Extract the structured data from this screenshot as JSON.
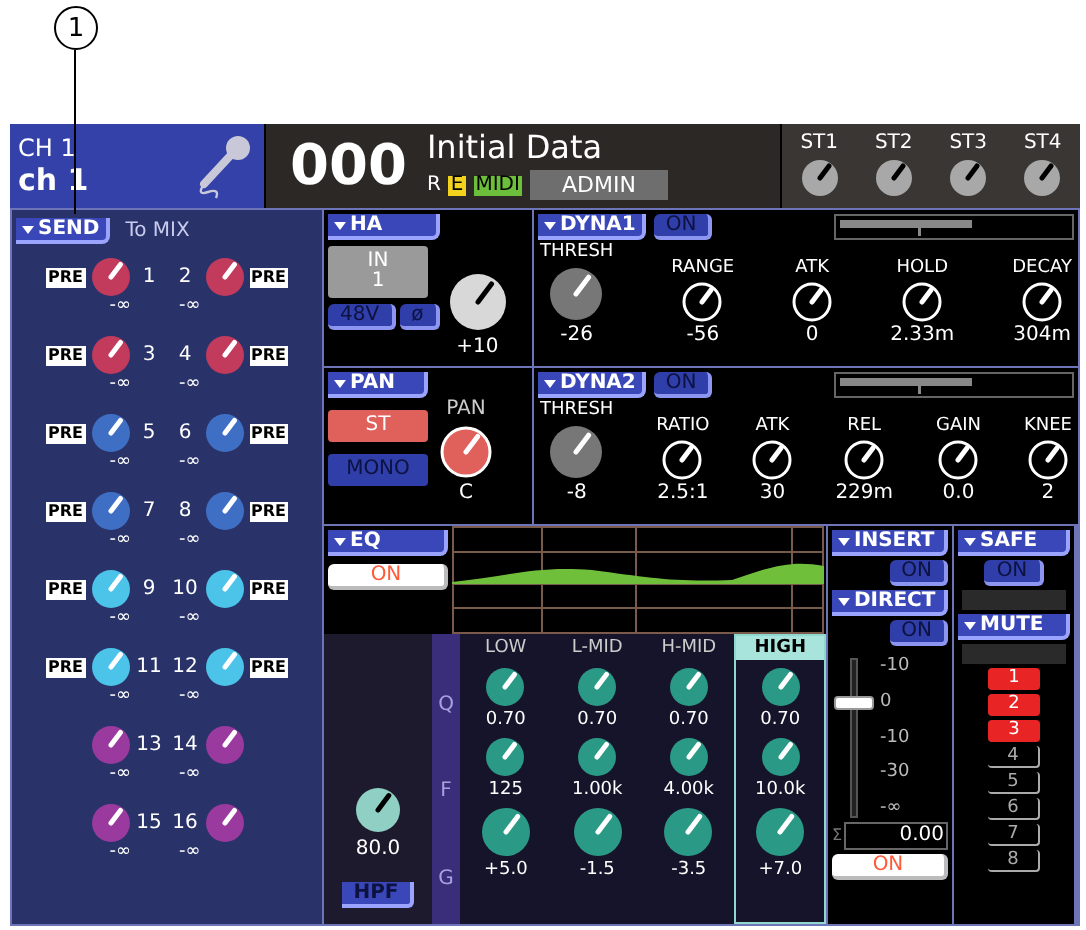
{
  "callout": "1",
  "header": {
    "channel_id": "CH 1",
    "channel_name": "ch 1",
    "scene_number": "000",
    "scene_title": "Initial Data",
    "indicators": [
      {
        "label": "R",
        "kind": "plain"
      },
      {
        "label": "E",
        "kind": "yellow"
      },
      {
        "label": "MIDI",
        "kind": "green"
      }
    ],
    "user": "ADMIN",
    "st_knobs": [
      {
        "label": "ST1"
      },
      {
        "label": "ST2"
      },
      {
        "label": "ST3"
      },
      {
        "label": "ST4"
      }
    ]
  },
  "send": {
    "button": "SEND",
    "title": "To MIX",
    "sends": [
      {
        "number": "1",
        "value": "-∞",
        "tag": "PRE",
        "color": "#c23a5c"
      },
      {
        "number": "2",
        "value": "-∞",
        "tag": "PRE",
        "color": "#c23a5c"
      },
      {
        "number": "3",
        "value": "-∞",
        "tag": "PRE",
        "color": "#c23a5c"
      },
      {
        "number": "4",
        "value": "-∞",
        "tag": "PRE",
        "color": "#c23a5c"
      },
      {
        "number": "5",
        "value": "-∞",
        "tag": "PRE",
        "color": "#3f6fc4"
      },
      {
        "number": "6",
        "value": "-∞",
        "tag": "PRE",
        "color": "#3f6fc4"
      },
      {
        "number": "7",
        "value": "-∞",
        "tag": "PRE",
        "color": "#3f6fc4"
      },
      {
        "number": "8",
        "value": "-∞",
        "tag": "PRE",
        "color": "#3f6fc4"
      },
      {
        "number": "9",
        "value": "-∞",
        "tag": "PRE",
        "color": "#4cc3e8"
      },
      {
        "number": "10",
        "value": "-∞",
        "tag": "PRE",
        "color": "#4cc3e8"
      },
      {
        "number": "11",
        "value": "-∞",
        "tag": "PRE",
        "color": "#4cc3e8"
      },
      {
        "number": "12",
        "value": "-∞",
        "tag": "PRE",
        "color": "#4cc3e8"
      },
      {
        "number": "13",
        "value": "-∞",
        "color": "#9a3a9e"
      },
      {
        "number": "14",
        "value": "-∞",
        "color": "#9a3a9e"
      },
      {
        "number": "15",
        "value": "-∞",
        "color": "#9a3a9e"
      },
      {
        "number": "16",
        "value": "-∞",
        "color": "#9a3a9e"
      }
    ]
  },
  "ha": {
    "button": "HA",
    "input": [
      "IN",
      "1"
    ],
    "phantom": "48V",
    "phase": "ø",
    "value": "+10"
  },
  "pan": {
    "button": "PAN",
    "st": "ST",
    "st_on": true,
    "mono": "MONO",
    "mono_on": false,
    "label": "PAN",
    "value": "C"
  },
  "dyna1": {
    "button": "DYNA1",
    "on": "ON",
    "params": [
      {
        "label": "THRESH",
        "value": "-26"
      },
      {
        "label": "RANGE",
        "value": "-56"
      },
      {
        "label": "ATK",
        "value": "0"
      },
      {
        "label": "HOLD",
        "value": "2.33m"
      },
      {
        "label": "DECAY",
        "value": "304m"
      }
    ]
  },
  "dyna2": {
    "button": "DYNA2",
    "on": "ON",
    "params": [
      {
        "label": "THRESH",
        "value": "-8"
      },
      {
        "label": "RATIO",
        "value": "2.5:1"
      },
      {
        "label": "ATK",
        "value": "30"
      },
      {
        "label": "REL",
        "value": "229m"
      },
      {
        "label": "GAIN",
        "value": "0.0"
      },
      {
        "label": "KNEE",
        "value": "2"
      }
    ]
  },
  "eq": {
    "button": "EQ",
    "on": "ON",
    "hpf_value": "80.0",
    "hpf": "HPF",
    "row_labels": [
      "Q",
      "F",
      "G"
    ],
    "bands": [
      {
        "name": "LOW",
        "selected": false,
        "values": [
          "0.70",
          "125",
          "+5.0"
        ]
      },
      {
        "name": "L-MID",
        "selected": false,
        "values": [
          "0.70",
          "1.00k",
          "-1.5"
        ]
      },
      {
        "name": "H-MID",
        "selected": false,
        "values": [
          "0.70",
          "4.00k",
          "-3.5"
        ]
      },
      {
        "name": "HIGH",
        "selected": true,
        "values": [
          "0.70",
          "10.0k",
          "+7.0"
        ]
      }
    ]
  },
  "insert": {
    "button": "INSERT",
    "on": "ON"
  },
  "direct": {
    "button": "DIRECT",
    "on": "ON"
  },
  "fader": {
    "scale": [
      "-10",
      "0",
      "-10",
      "-30",
      "-∞"
    ],
    "level": 0.75,
    "sum": "Σ",
    "value": "0.00",
    "on": "ON"
  },
  "safe": {
    "button": "SAFE",
    "on": "ON"
  },
  "mute": {
    "button": "MUTE",
    "groups": [
      {
        "label": "1",
        "on": true
      },
      {
        "label": "2",
        "on": true
      },
      {
        "label": "3",
        "on": true
      },
      {
        "label": "4",
        "on": false
      },
      {
        "label": "5",
        "on": false
      },
      {
        "label": "6",
        "on": false
      },
      {
        "label": "7",
        "on": false
      },
      {
        "label": "8",
        "on": false
      }
    ]
  }
}
